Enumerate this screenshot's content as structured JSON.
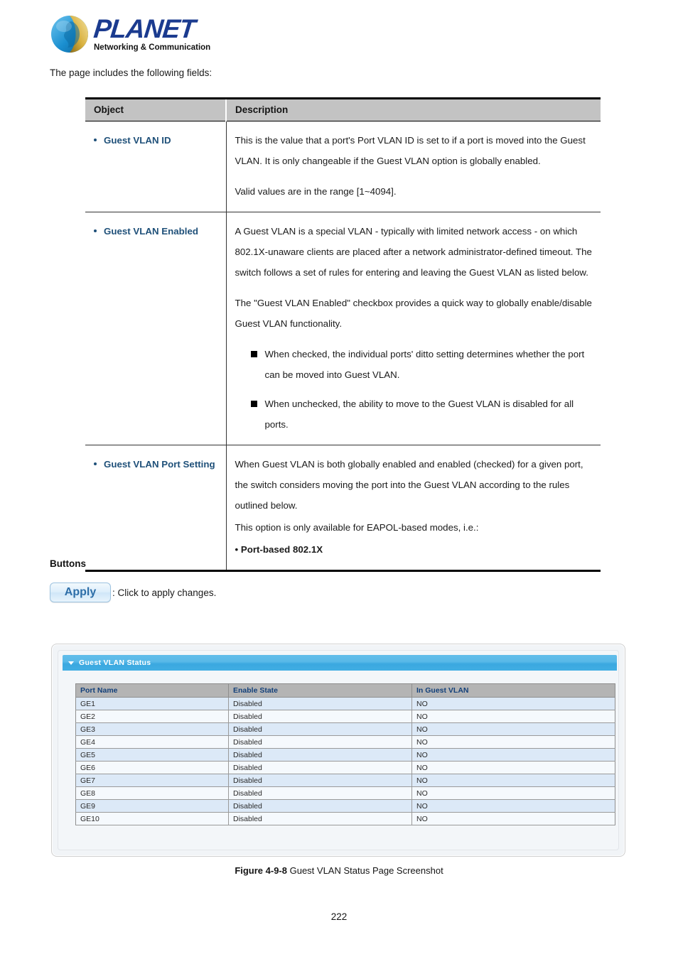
{
  "brand": {
    "name": "PLANET",
    "tagline": "Networking & Communication",
    "logo_icon": "planet-globe-logo",
    "color": "#1b3b8f"
  },
  "intro_text": "The page includes the following fields:",
  "fields_table": {
    "headers": {
      "object": "Object",
      "description": "Description"
    },
    "rows": [
      {
        "object": "Guest VLAN ID",
        "paragraphs": [
          "This is the value that a port's Port VLAN ID is set to if a port is moved into the Guest VLAN. It is only changeable if the Guest VLAN option is globally enabled.",
          "Valid values are in the range [1~4094]."
        ],
        "bullets": []
      },
      {
        "object": "Guest VLAN Enabled",
        "paragraphs": [
          "A Guest VLAN is a special VLAN - typically with limited network access - on which 802.1X-unaware clients are placed after a network administrator-defined timeout. The switch follows a set of rules for entering and leaving the Guest VLAN as listed below.",
          "The \"Guest VLAN Enabled\" checkbox provides a quick way to globally enable/disable Guest VLAN functionality."
        ],
        "bullets": [
          "When checked, the individual ports' ditto setting determines whether the port can be moved into Guest VLAN.",
          "When unchecked, the ability to move to the Guest VLAN is disabled for all ports."
        ]
      },
      {
        "object": "Guest VLAN Port Setting",
        "paragraphs": [
          "When Guest VLAN is both globally enabled and enabled (checked) for a given port, the switch considers moving the port into the Guest VLAN according to the rules outlined below.",
          "This option is only available for EAPOL-based modes, i.e.:"
        ],
        "bold_line": "• Port-based 802.1X",
        "bullets": []
      }
    ]
  },
  "buttons_section": {
    "heading": "Buttons",
    "apply_label": "Apply",
    "apply_caption": ": Click to apply changes."
  },
  "screenshot_panel": {
    "panel_title": "Guest VLAN Status",
    "caret_icon": "triangle-down-icon",
    "header_color": "#4cb2e4",
    "table": {
      "headers": [
        "Port Name",
        "Enable State",
        "In Guest VLAN"
      ],
      "rows": [
        [
          "GE1",
          "Disabled",
          "NO"
        ],
        [
          "GE2",
          "Disabled",
          "NO"
        ],
        [
          "GE3",
          "Disabled",
          "NO"
        ],
        [
          "GE4",
          "Disabled",
          "NO"
        ],
        [
          "GE5",
          "Disabled",
          "NO"
        ],
        [
          "GE6",
          "Disabled",
          "NO"
        ],
        [
          "GE7",
          "Disabled",
          "NO"
        ],
        [
          "GE8",
          "Disabled",
          "NO"
        ],
        [
          "GE9",
          "Disabled",
          "NO"
        ],
        [
          "GE10",
          "Disabled",
          "NO"
        ]
      ]
    }
  },
  "figure_caption": {
    "label": "Figure 4-9-8",
    "text": " Guest VLAN Status Page Screenshot"
  },
  "page_number": "222"
}
